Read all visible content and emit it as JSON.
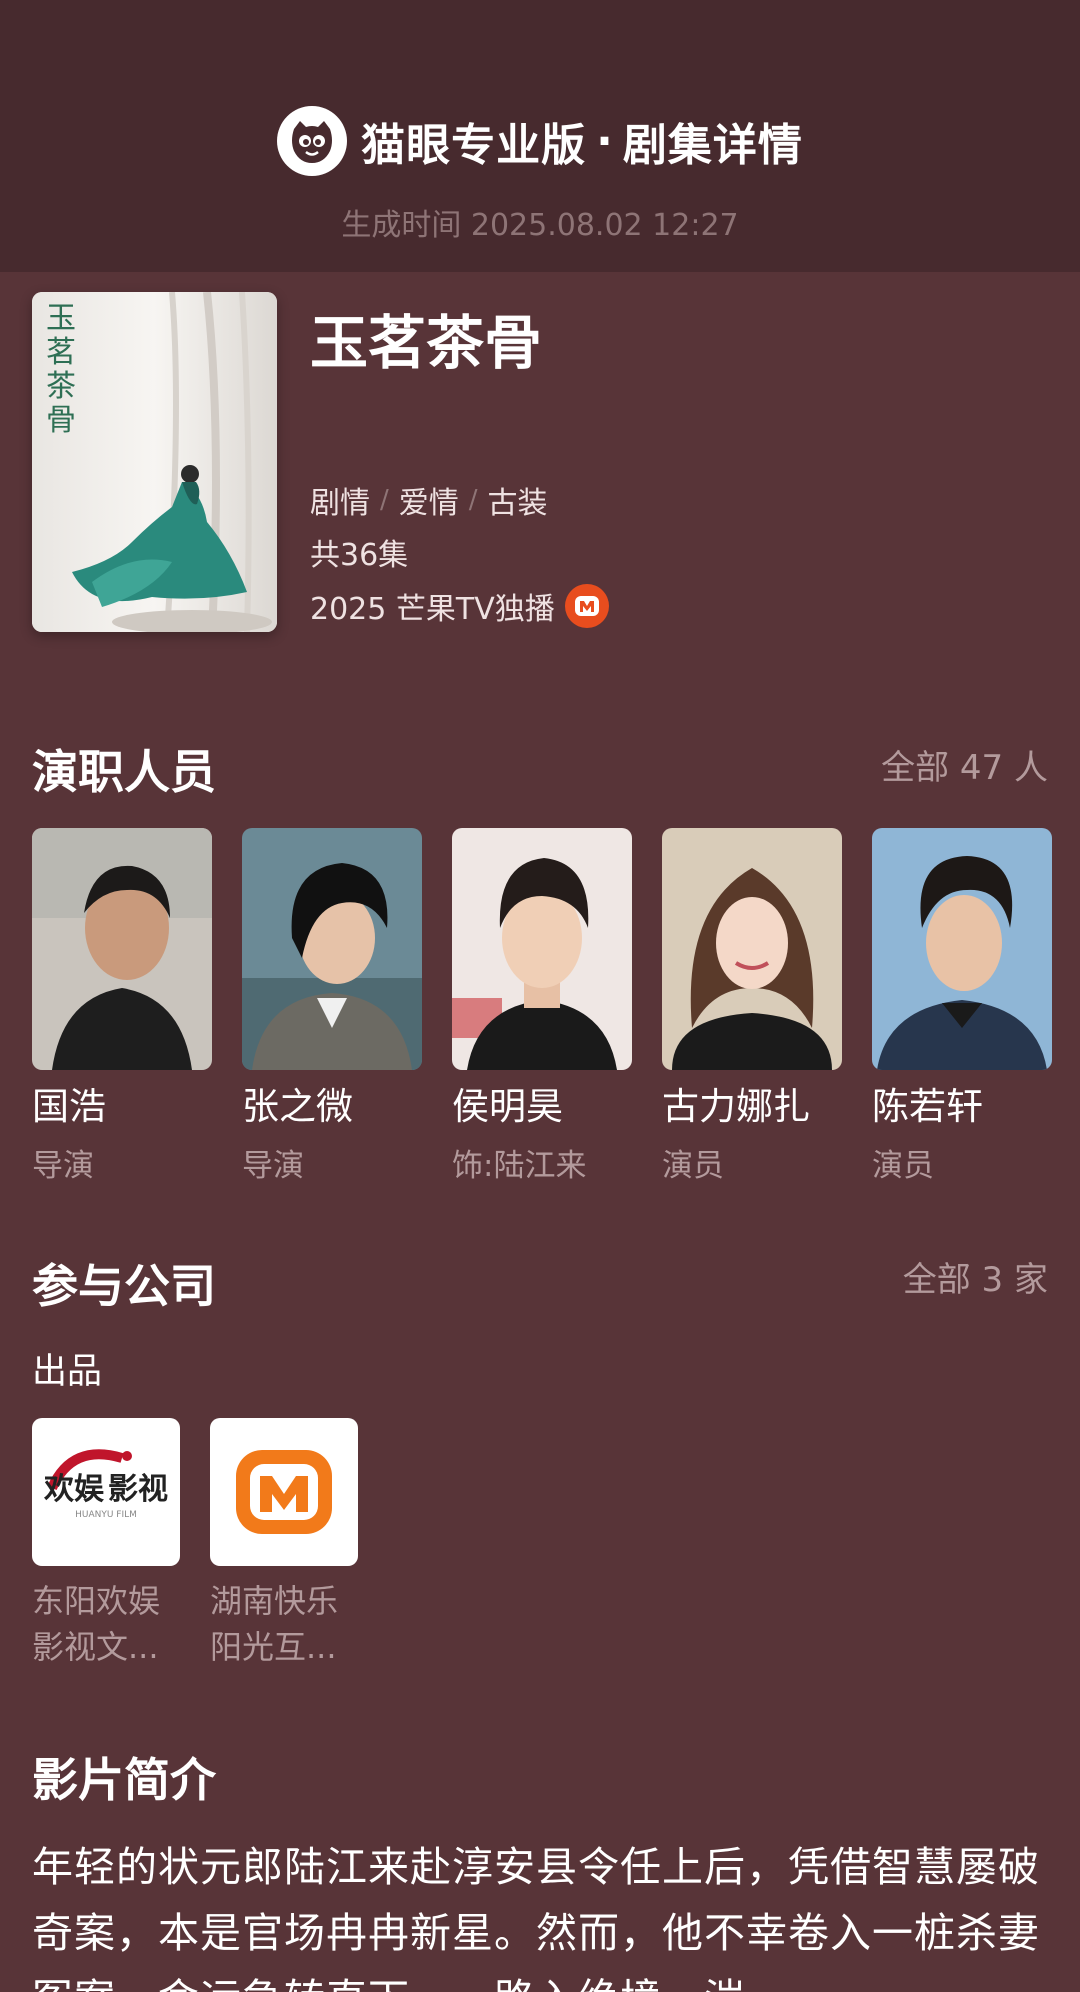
{
  "header": {
    "brand_title": "猫眼专业版",
    "brand_separator": "·",
    "brand_subtitle": "剧集详情",
    "generated_time": "生成时间 2025.08.02 12:27"
  },
  "drama": {
    "poster_text": "玉茗茶骨",
    "title": "玉茗茶骨",
    "genres": [
      "剧情",
      "爱情",
      "古装"
    ],
    "genre_separator": "/",
    "episodes": "共36集",
    "release": "2025 芒果TV独播",
    "platform_icon": "mango-tv-icon"
  },
  "cast_section": {
    "title": "演职人员",
    "more": "全部 47 人",
    "members": [
      {
        "name": "国浩",
        "role": "导演"
      },
      {
        "name": "张之微",
        "role": "导演"
      },
      {
        "name": "侯明昊",
        "role": "饰:陆江来"
      },
      {
        "name": "古力娜扎",
        "role": "演员"
      },
      {
        "name": "陈若轩",
        "role": "演员"
      }
    ]
  },
  "company_section": {
    "title": "参与公司",
    "more": "全部 3 家",
    "category": "出品",
    "companies": [
      {
        "name_line1": "东阳欢娱",
        "name_line2": "影视文...",
        "logo_main": "欢娱",
        "logo_side": "影视",
        "logo_en": "HUANYU FILM"
      },
      {
        "name_line1": "湖南快乐",
        "name_line2": "阳光互...",
        "logo_main": "",
        "logo_side": "",
        "logo_en": ""
      }
    ]
  },
  "synopsis_section": {
    "title": "影片简介",
    "text": "年轻的状元郎陆江来赴淳安县令任上后，凭借智慧屡破奇案，本是官场冉冉新星。然而，他不幸卷入一桩杀妻冤案，命运急转直下，一路入绝境。湍"
  },
  "colors": {
    "background": "#583438",
    "header_bg": "#472a2e",
    "muted_text": "#b39a9c",
    "mango_orange": "#e84d1e"
  }
}
